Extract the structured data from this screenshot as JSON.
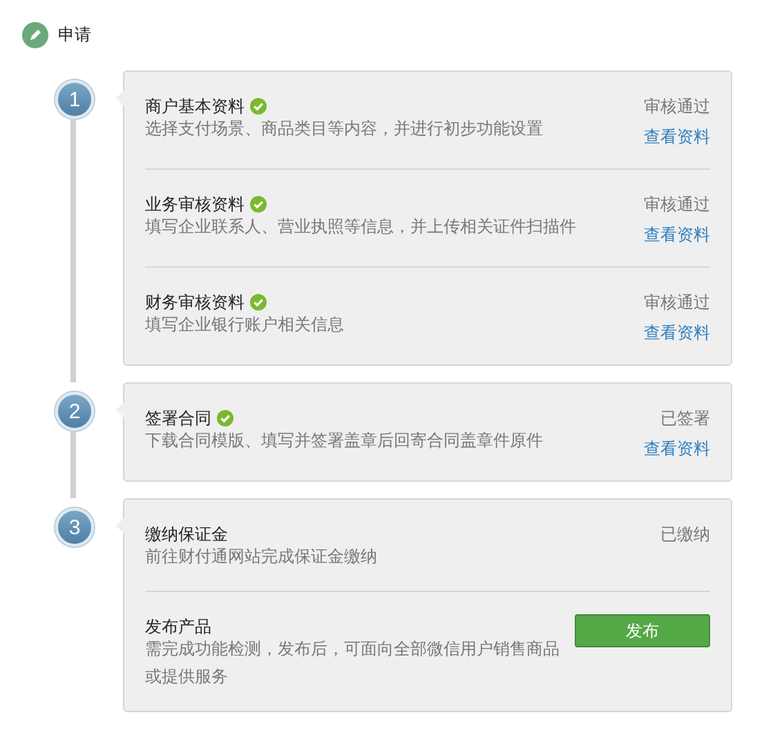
{
  "header": {
    "title": "申请"
  },
  "steps": [
    {
      "number": "1",
      "items": [
        {
          "title": "商户基本资料",
          "verified": true,
          "description": "选择支付场景、商品类目等内容，并进行初步功能设置",
          "status": "审核通过",
          "action": {
            "kind": "link",
            "label": "查看资料"
          }
        },
        {
          "title": "业务审核资料",
          "verified": true,
          "description": "填写企业联系人、营业执照等信息，并上传相关证件扫描件",
          "status": "审核通过",
          "action": {
            "kind": "link",
            "label": "查看资料"
          }
        },
        {
          "title": "财务审核资料",
          "verified": true,
          "description": "填写企业银行账户相关信息",
          "status": "审核通过",
          "action": {
            "kind": "link",
            "label": "查看资料"
          }
        }
      ]
    },
    {
      "number": "2",
      "items": [
        {
          "title": "签署合同",
          "verified": true,
          "description": "下载合同模版、填写并签署盖章后回寄合同盖章件原件",
          "status": "已签署",
          "action": {
            "kind": "link",
            "label": "查看资料"
          }
        }
      ]
    },
    {
      "number": "3",
      "items": [
        {
          "title": "缴纳保证金",
          "verified": false,
          "description": "前往财付通网站完成保证金缴纳",
          "status": "已缴纳"
        },
        {
          "title": "发布产品",
          "verified": false,
          "description": "需完成功能检测，发布后，可面向全部微信用户销售商品或提供服务",
          "action": {
            "kind": "button",
            "label": "发布"
          }
        }
      ]
    }
  ]
}
